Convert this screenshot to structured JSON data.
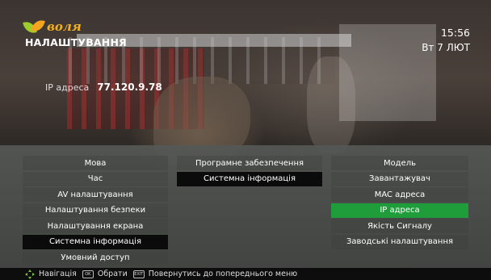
{
  "header": {
    "logo_text": "воля",
    "page_title": "НАЛАШТУВАННЯ",
    "time": "15:56",
    "date": "Вт 7 ЛЮТ"
  },
  "info": {
    "ip_label": "IP адреса",
    "ip_value": "77.120.9.78"
  },
  "menu": {
    "column1": [
      {
        "label": "Мова"
      },
      {
        "label": "Час"
      },
      {
        "label": "AV налаштування"
      },
      {
        "label": "Налаштування безпеки"
      },
      {
        "label": "Налаштування екрана"
      },
      {
        "label": "Системна інформація",
        "state": "selected"
      },
      {
        "label": "Умовний доступ"
      }
    ],
    "column2": [
      {
        "label": "Програмне забезпечення"
      },
      {
        "label": "Системна інформація",
        "state": "selected"
      }
    ],
    "column3": [
      {
        "label": "Модель"
      },
      {
        "label": "Завантажувач"
      },
      {
        "label": "MAC адреса"
      },
      {
        "label": "IP адреса",
        "state": "active"
      },
      {
        "label": "Якість Сигналу"
      },
      {
        "label": "Заводські налаштування"
      }
    ]
  },
  "footer": {
    "navigate_label": "Навігація",
    "ok_key": "OK",
    "select_label": "Обрати",
    "back_key": "EXIT",
    "back_label": "Повернутись до попереднього меню"
  },
  "colors": {
    "active_highlight": "#1e9d3a",
    "selected_highlight": "#0b0b0b",
    "logo_orange": "#f5b020",
    "logo_green": "#9ccd2a"
  },
  "icons": {
    "logo": "volia-logo-icon",
    "navigate": "four-way-arrows-icon",
    "ok_button": "ok-key-icon",
    "back_button": "exit-key-icon"
  }
}
